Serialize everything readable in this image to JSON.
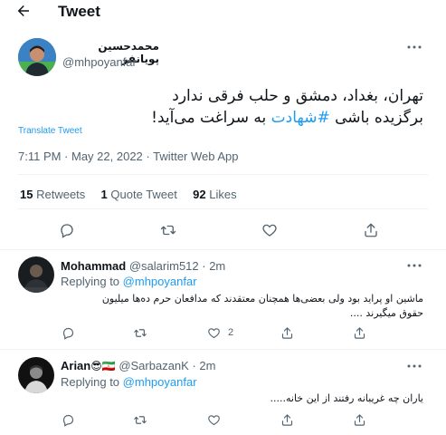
{
  "header": {
    "title": "Tweet"
  },
  "tweet": {
    "author_name": "محمدحسین پویانفر",
    "author_handle": "@mhpoyanfar",
    "text_line1": "تهران، بغداد، دمشق و حلب فرقی ندارد",
    "text_line2_pre": "برگزیده باشی ",
    "text_hashtag": "#شهادت",
    "text_line2_post": " به سراغت می‌آید!",
    "translate": "Translate Tweet",
    "timestamp": "7:11 PM · May 22, 2022 · Twitter Web App",
    "stats": {
      "retweets_count": "15",
      "retweets_label": "Retweets",
      "quotes_count": "1",
      "quotes_label": "Quote Tweet",
      "likes_count": "92",
      "likes_label": "Likes"
    }
  },
  "replies": [
    {
      "name": "Mohammad",
      "handle": "@salarim512",
      "time": "· 2m",
      "replying_prefix": "Replying to",
      "replying_to": "@mhpoyanfar",
      "text_line1": "ماشین او پراید بود ولی بعضی‌ها همچنان معتقدند که مدافعان حرم ده‌ها میلیون",
      "text_line2": "حقوق میگیرند ....",
      "like_count": "2"
    },
    {
      "name": "Arian",
      "emojis": "😎🇮🇷",
      "handle": "@SarbazanK",
      "time": "· 2m",
      "replying_prefix": "Replying to",
      "replying_to": "@mhpoyanfar",
      "text_line1": "یاران چه غریبانه رفتند از این خانه....."
    }
  ],
  "colors": {
    "accent": "#1d9bf0",
    "muted": "#536471",
    "divider": "#eff3f4",
    "text": "#0f1419"
  },
  "icons": [
    "back-arrow-icon",
    "more-icon",
    "reply-icon",
    "retweet-icon",
    "like-icon",
    "share-icon"
  ]
}
